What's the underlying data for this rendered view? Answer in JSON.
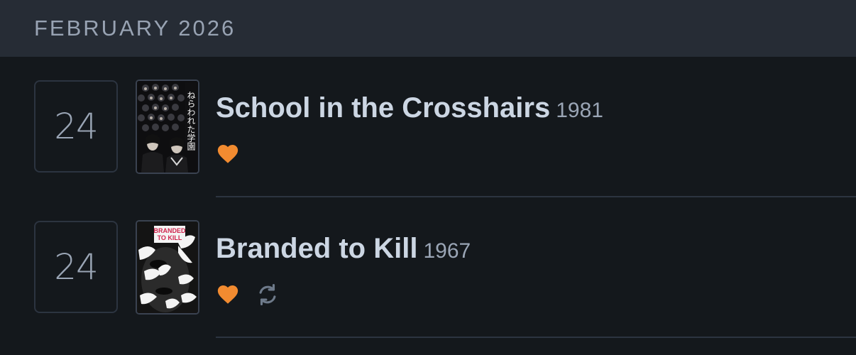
{
  "month_header": {
    "label": "FEBRUARY 2026"
  },
  "entries": [
    {
      "day": "24",
      "title": "School in the Crosshairs",
      "year": "1981",
      "poster_text": "ねらわれた学園",
      "icons": [
        "heart-icon"
      ]
    },
    {
      "day": "24",
      "title": "Branded to Kill",
      "year": "1967",
      "poster_text": "BRANDED TO KILL",
      "poster_text_lines": [
        "BRANDED",
        "TO KILL"
      ],
      "icons": [
        "heart-icon",
        "rewatch-icon"
      ]
    }
  ],
  "colors": {
    "header_bg": "#262c35",
    "page_bg": "#14181c",
    "liked_orange": "#f28b30",
    "rewatch_gray": "#6e7a8a"
  }
}
